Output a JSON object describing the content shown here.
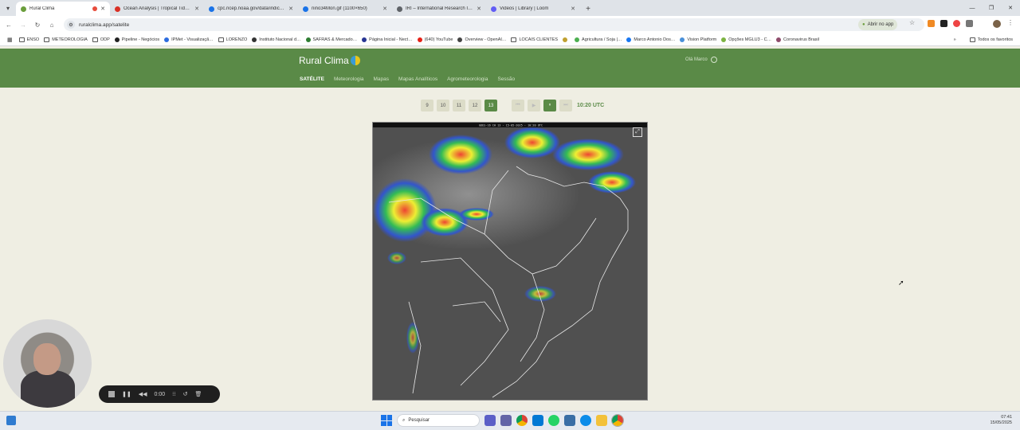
{
  "browser": {
    "tabs": [
      {
        "title": "Rural Clima",
        "color": "#6b9e3c",
        "active": true,
        "recording": true
      },
      {
        "title": "Ocean Analysis | Tropical Tidbits",
        "color": "#d93025"
      },
      {
        "title": "cpc.ncep.noaa.gov/data/indic…",
        "color": "#1a73e8"
      },
      {
        "title": "nino34Mon.gif (1100×650)",
        "color": "#1a73e8"
      },
      {
        "title": "IRI – International Research Inst…",
        "color": "#5f6368"
      },
      {
        "title": "Videos | Library | Loom",
        "color": "#625df5"
      }
    ],
    "new_tab": "+",
    "url": "ruralclima.app/satelite",
    "open_app": "Abrir no app",
    "bookmarks": [
      {
        "label": "ENSO",
        "kind": "folder"
      },
      {
        "label": "METEOROLOGIA",
        "kind": "folder"
      },
      {
        "label": "ODP",
        "kind": "folder"
      },
      {
        "label": "Pipeline - Negócios",
        "kind": "site",
        "color": "#222"
      },
      {
        "label": "IPMet - Visualizaçã…",
        "kind": "site",
        "color": "#2d6cdf"
      },
      {
        "label": "LORENZO",
        "kind": "folder"
      },
      {
        "label": "Instituto Nacional d…",
        "kind": "site",
        "color": "#333"
      },
      {
        "label": "SAFRAS & Mercado…",
        "kind": "site",
        "color": "#2e7d32"
      },
      {
        "label": "Página Inicial - Nect…",
        "kind": "site",
        "color": "#283593"
      },
      {
        "label": "(640) YouTube",
        "kind": "site",
        "color": "#e62117"
      },
      {
        "label": "Overview - OpenAI…",
        "kind": "site",
        "color": "#444"
      },
      {
        "label": "LOCAIS CLIENTES",
        "kind": "folder"
      },
      {
        "label": "",
        "kind": "site",
        "color": "#c0a030"
      },
      {
        "label": "Agricultura / Soja |…",
        "kind": "site",
        "color": "#4caf50"
      },
      {
        "label": "Marco Antonio Dos…",
        "kind": "site",
        "color": "#1877f2"
      },
      {
        "label": "Vision Platform",
        "kind": "site",
        "color": "#4a90d9"
      },
      {
        "label": "Opções MGLU3 - C…",
        "kind": "site",
        "color": "#7cb342"
      },
      {
        "label": "Coronavirus Brasil",
        "kind": "site",
        "color": "#8e4b6b"
      }
    ],
    "bookmarks_more": "»",
    "all_favorites": "Todos os favoritos"
  },
  "site": {
    "logo": "Rural Clima",
    "greeting": "Olá Marco",
    "nav": [
      {
        "label": "SATÉLITE",
        "active": true
      },
      {
        "label": "Meteorologia"
      },
      {
        "label": "Mapas"
      },
      {
        "label": "Mapas Analíticos"
      },
      {
        "label": "Agrometeorologia"
      },
      {
        "label": "Sessão"
      }
    ],
    "hours": [
      "9",
      "10",
      "11",
      "12",
      "13"
    ],
    "selected_hour": "13",
    "player": [
      "⏮",
      "▶",
      "⏸",
      "⏭"
    ],
    "time": "10:20 UTC",
    "image_header": "GOES-16 CH 13 · 15-05-2025 · 10:20 UTC",
    "expand_icon": "⤢"
  },
  "loom": {
    "timer": "0:00"
  },
  "taskbar": {
    "search": "Pesquisar",
    "time": "07:41",
    "date": "15/05/2025"
  }
}
